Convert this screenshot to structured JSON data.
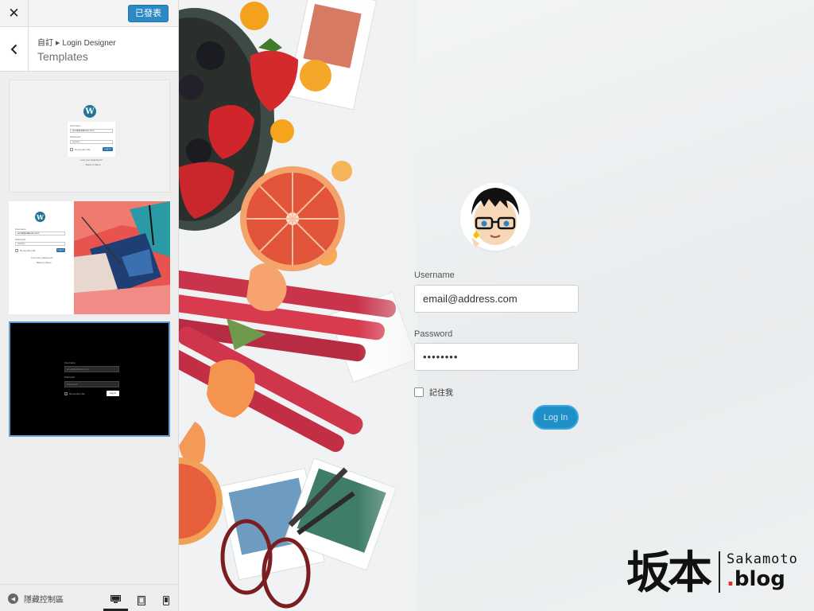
{
  "topbar": {
    "close_icon": "close-icon",
    "publish_label": "已發表"
  },
  "section": {
    "back_icon": "chevron-left-icon",
    "breadcrumb_parent": "自訂",
    "breadcrumb_child": "Login Designer",
    "title": "Templates"
  },
  "templates": [
    {
      "name": "default",
      "username_label": "Username",
      "username_value": "email@address.com",
      "password_label": "Password",
      "password_value": "•••••••••",
      "remember_label": "Remember Me",
      "button_label": "Log In",
      "lost_password": "Lost your password?",
      "back_link": "← Back to Name"
    },
    {
      "name": "split-image",
      "username_label": "Username",
      "username_value": "email@address.com",
      "password_label": "Password",
      "password_value": "•••••••••",
      "remember_label": "Remember Me",
      "button_label": "Log In",
      "lost_password": "Lost your password?",
      "back_link": "← Back to Name"
    },
    {
      "name": "dark",
      "username_label": "Username",
      "username_value": "email@address.com",
      "password_label": "Password",
      "password_value": "Password",
      "remember_label": "Remember Me",
      "button_label": "Log In"
    }
  ],
  "footer": {
    "collapse_label": "隱藏控制區",
    "devices": [
      "desktop-icon",
      "tablet-icon",
      "mobile-icon"
    ],
    "active_device": "desktop"
  },
  "login_form": {
    "username_label": "Username",
    "username_value": "email@address.com",
    "password_label": "Password",
    "password_value": "••••••••",
    "remember_label": "記住我",
    "button_label": "Log In"
  },
  "watermark": {
    "kanji": "坂本",
    "name": "Sakamoto",
    "dot": ".",
    "blog": "blog"
  },
  "colors": {
    "publish_button": "#2d89c4",
    "login_button": "#1f8fc7",
    "template_selected_border": "#5b9dd9",
    "watermark_dot": "#e02b20"
  }
}
